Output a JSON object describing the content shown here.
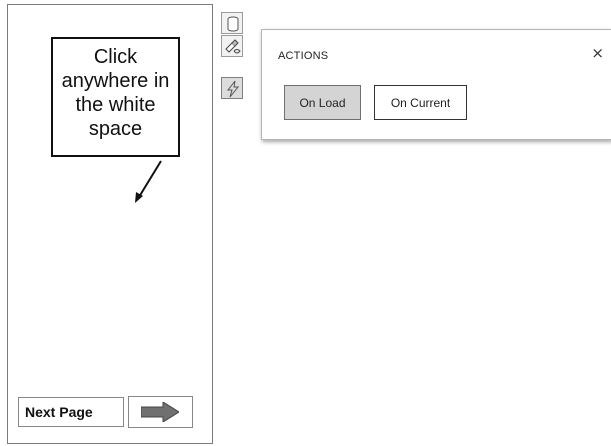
{
  "callout": {
    "lines": [
      "Click",
      "anywhere in",
      "the white",
      "space"
    ]
  },
  "navigation": {
    "next_label": "Next Page",
    "arrow_icon": "right-arrow-icon",
    "arrow_color": "#707070"
  },
  "toolbar": {
    "icons": [
      "data-source-icon",
      "formatting-icon",
      "actions-icon"
    ],
    "active_icon": "actions-icon"
  },
  "actions_popup": {
    "title": "ACTIONS",
    "close_symbol": "×",
    "buttons": [
      {
        "label": "On Load",
        "state": "selected"
      },
      {
        "label": "On Current",
        "state": "normal"
      }
    ]
  },
  "colors": {
    "selected_button": "#d4d4d4",
    "border": "#7a7a7a"
  }
}
